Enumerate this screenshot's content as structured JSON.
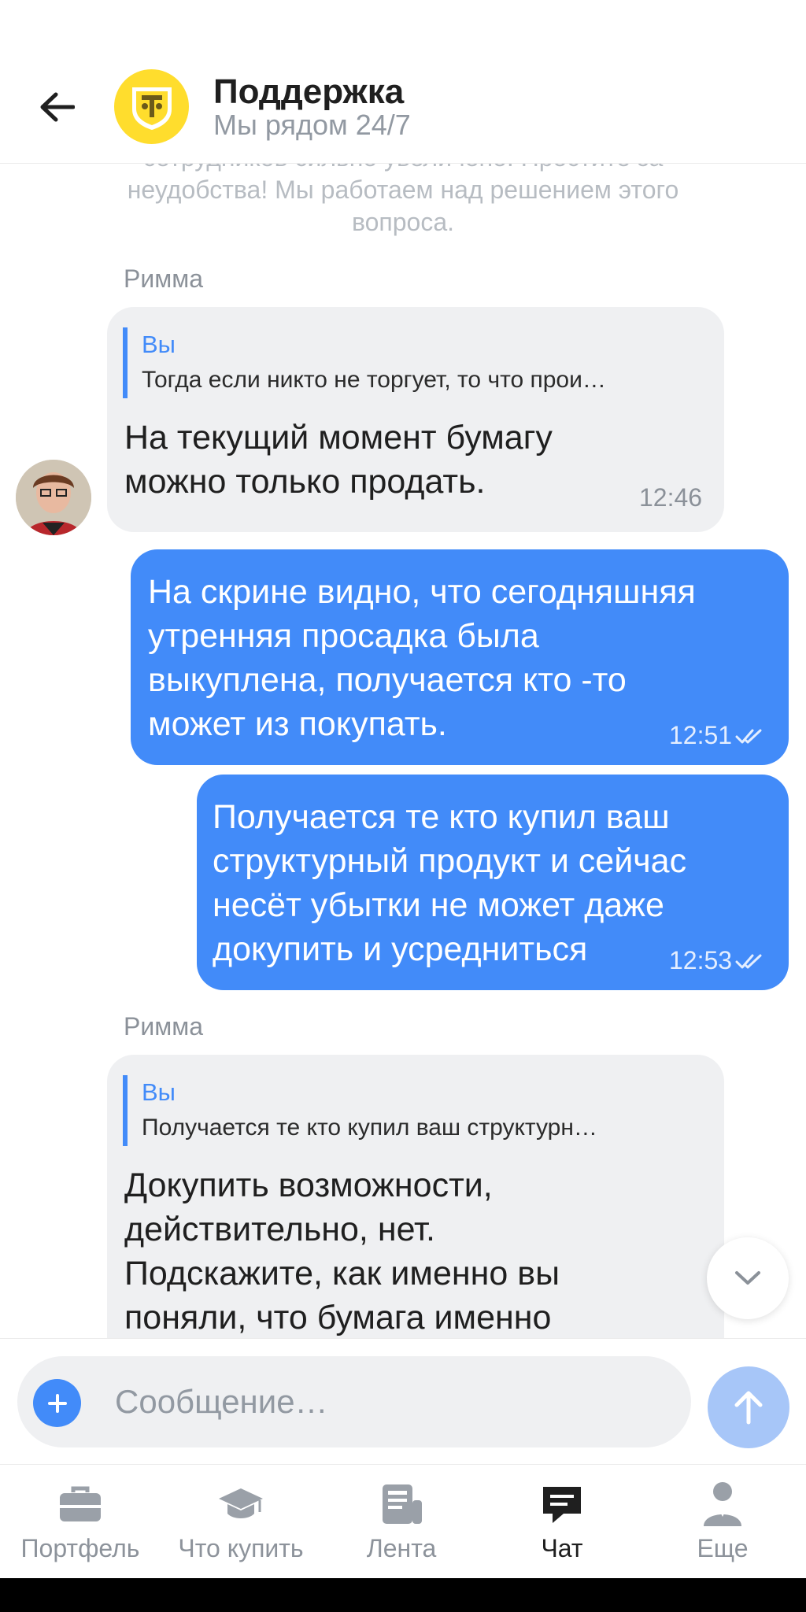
{
  "header": {
    "title": "Поддержка",
    "subtitle": "Мы рядом 24/7"
  },
  "chat": {
    "system_notice": "сотрудников сильно увеличено. Простите за\nнеудобства! Мы работаем над решением этого\nвопроса.",
    "messages": [
      {
        "sender": "Римма",
        "quote_author": "Вы",
        "quote_text": "Тогда если никто не торгует, то что прои…",
        "text": "На текущий момент бумагу\nможно только продать.",
        "time": "12:46"
      },
      {
        "text": "На скрине видно, что сегодняшняя\nутренняя просадка была\nвыкуплена, получается кто -то\nможет из покупать.",
        "time": "12:51",
        "status": "read"
      },
      {
        "text": "Получается те кто купил ваш\nструктурный продукт и сейчас\nнесёт убытки не может даже\nдокупить и усредниться",
        "time": "12:53",
        "status": "read"
      },
      {
        "sender": "Римма",
        "quote_author": "Вы",
        "quote_text": "Получается те кто купил ваш структурн…",
        "text": "Докупить возможности,\nдействительно, нет.\nПодскажите, как именно вы\nпоняли, что бумага именно"
      }
    ]
  },
  "composer": {
    "placeholder": "Сообщение…"
  },
  "tabs": [
    {
      "label": "Портфель",
      "icon": "briefcase-icon"
    },
    {
      "label": "Что купить",
      "icon": "graduation-cap-icon"
    },
    {
      "label": "Лента",
      "icon": "news-icon"
    },
    {
      "label": "Чат",
      "icon": "chat-icon",
      "active": true
    },
    {
      "label": "Еще",
      "icon": "profile-icon"
    }
  ],
  "colors": {
    "accent": "#428bf9",
    "bubble_in": "#eff0f2",
    "brand_yellow": "#ffdd2d"
  }
}
